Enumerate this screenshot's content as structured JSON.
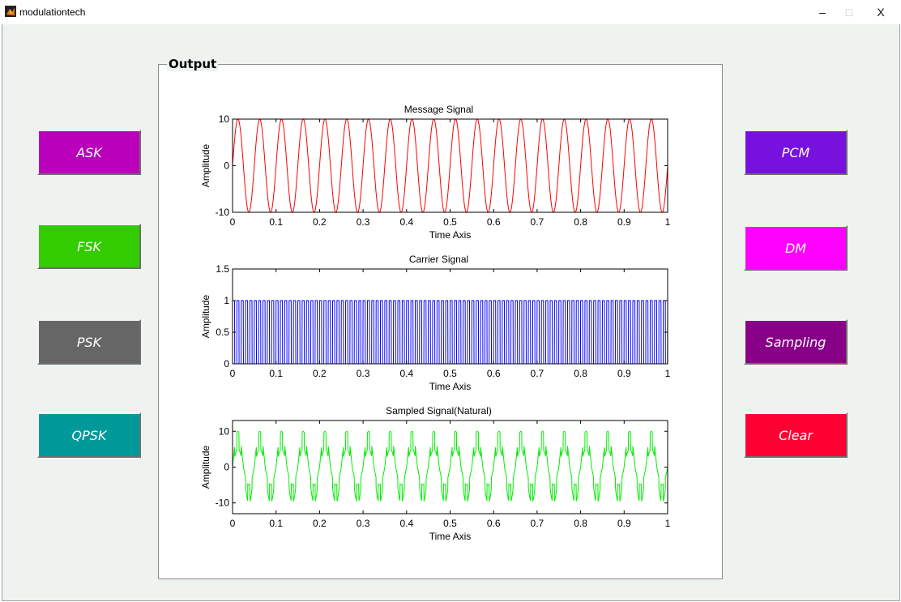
{
  "window": {
    "title": "modulationtech",
    "minimize_glyph": "–",
    "maximize_glyph": "□",
    "close_glyph": "X"
  },
  "panel": {
    "title": "Output"
  },
  "buttons_left": [
    {
      "label": "ASK",
      "color": "#bb00bb"
    },
    {
      "label": "FSK",
      "color": "#33cc00"
    },
    {
      "label": "PSK",
      "color": "#666666"
    },
    {
      "label": "QPSK",
      "color": "#009999"
    }
  ],
  "buttons_right": [
    {
      "label": "PCM",
      "color": "#7711dd"
    },
    {
      "label": "DM",
      "color": "#ff00ff"
    },
    {
      "label": "Sampling",
      "color": "#880088"
    },
    {
      "label": "Clear",
      "color": "#ff0033"
    }
  ],
  "chart_data": [
    {
      "type": "line",
      "title": "Message Signal",
      "xlabel": "Time Axis",
      "ylabel": "Amplitude",
      "xlim": [
        0,
        1
      ],
      "ylim": [
        -10,
        10
      ],
      "xticks": [
        "0",
        "0.1",
        "0.2",
        "0.3",
        "0.4",
        "0.5",
        "0.6",
        "0.7",
        "0.8",
        "0.9",
        "1"
      ],
      "yticks": [
        "-10",
        "0",
        "10"
      ],
      "series": [
        {
          "function": "10*sin(2*pi*20*t)",
          "frequency_hz": 20,
          "amplitude": 10,
          "color": "#ff0000"
        }
      ]
    },
    {
      "type": "line",
      "title": "Carrier Signal",
      "xlabel": "Time Axis",
      "ylabel": "Amplitude",
      "xlim": [
        0,
        1
      ],
      "ylim": [
        0,
        1.5
      ],
      "xticks": [
        "0",
        "0.1",
        "0.2",
        "0.3",
        "0.4",
        "0.5",
        "0.6",
        "0.7",
        "0.8",
        "0.9",
        "1"
      ],
      "yticks": [
        "0",
        "0.5",
        "1",
        "1.5"
      ],
      "series": [
        {
          "function": "square pulse train 0/1",
          "frequency_hz": 100,
          "high": 1,
          "low": 0,
          "color": "#0000ff"
        }
      ]
    },
    {
      "type": "line",
      "title": "Sampled Signal(Natural)",
      "xlabel": "Time Axis",
      "ylabel": "Amplitude",
      "xlim": [
        0,
        1
      ],
      "ylim": [
        -13,
        13
      ],
      "xticks": [
        "0",
        "0.1",
        "0.2",
        "0.3",
        "0.4",
        "0.5",
        "0.6",
        "0.7",
        "0.8",
        "0.9",
        "1"
      ],
      "yticks": [
        "-10",
        "0",
        "10"
      ],
      "series": [
        {
          "function": "message x carrier (natural sampling)",
          "frequency_hz": 20,
          "amplitude": 10,
          "color": "#00ee00"
        }
      ]
    }
  ]
}
